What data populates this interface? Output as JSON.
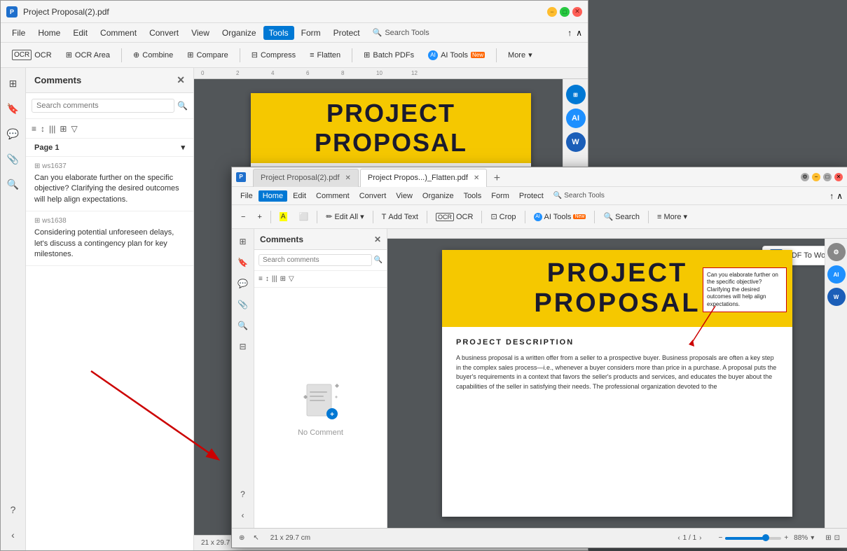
{
  "back_window": {
    "title": "Project Proposal(2).pdf",
    "tabs": [
      {
        "label": "Project Proposal(2).pdf",
        "active": true
      }
    ],
    "menu": {
      "items": [
        "File",
        "Home",
        "Edit",
        "Comment",
        "Convert",
        "View",
        "Organize",
        "Tools",
        "Form",
        "Protect"
      ]
    },
    "active_menu": "Tools",
    "toolbar": {
      "items": [
        "OCR",
        "OCR Area",
        "Combine",
        "Compare",
        "Compress",
        "Flatten",
        "Batch PDFs",
        "AI Tools",
        "More"
      ]
    },
    "comments_panel": {
      "title": "Comments",
      "search_placeholder": "Search comments",
      "page_label": "Page 1",
      "comments": [
        {
          "id": "ws1637",
          "text": "Can you elaborate further on the specific objective? Clarifying the desired outcomes will help align expectations."
        },
        {
          "id": "ws1638",
          "text": "Considering potential unforeseen delays, let's discuss a contingency plan for key milestones."
        }
      ]
    },
    "pdf": {
      "title_line1": "PROJECT",
      "title_line2": "PROPOSAL"
    },
    "status": "21 x 29.7 cm"
  },
  "front_window": {
    "title_tabs": [
      {
        "label": "Project Proposal(2).pdf",
        "active": false
      },
      {
        "label": "Project Propos...)_Flatten.pdf",
        "active": true
      }
    ],
    "menu": {
      "items": [
        "File",
        "Home",
        "Edit",
        "Comment",
        "Convert",
        "View",
        "Organize",
        "Tools",
        "Form",
        "Protect"
      ]
    },
    "active_menu": "Home",
    "toolbar": {
      "zoom_out": "−",
      "zoom_in": "+",
      "highlight": "✎",
      "edit_all": "Edit All",
      "add_text": "Add Text",
      "ocr": "OCR",
      "crop": "Crop",
      "ai_tools": "AI Tools",
      "search": "Search",
      "more": "More"
    },
    "comments_panel": {
      "title": "Comments",
      "search_placeholder": "Search comments",
      "no_comment_label": "No Comment"
    },
    "pdf": {
      "title_line1": "PROJECT",
      "title_line2": "PROPOSAL",
      "section_title": "PROJECT DESCRIPTION",
      "body_text": "A business proposal is a written offer from a seller to a prospective buyer. Business proposals are often a key step in the complex sales process—i.e., whenever a buyer considers more than price in a purchase. A proposal puts the buyer's requirements in a context that favors the seller's products and services, and educates the buyer about the capabilities of the seller in satisfying their needs. The professional organization devoted to the"
    },
    "comment_balloon": "Can you elaborate further on the specific objective? Clarifying the desired outcomes will help align expectations.",
    "pdf_to_word_label": "PDF To Word",
    "status": {
      "size": "21 x 29.7 cm",
      "page": "1",
      "total": "1",
      "zoom": "88%"
    }
  },
  "icons": {
    "close": "✕",
    "minimize": "−",
    "maximize": "□",
    "search": "🔍",
    "filter": "▼",
    "chevron_down": "▾",
    "chevron_right": "›",
    "settings": "⚙",
    "pdf_icon": "PDF",
    "ai_blue": "AI",
    "ms_word_blue": "W",
    "ocr_icon": "OCR"
  }
}
